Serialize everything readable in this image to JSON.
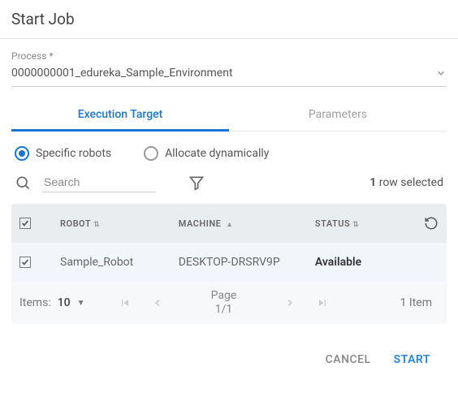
{
  "title": "Start Job",
  "process": {
    "label": "Process *",
    "value": "0000000001_edureka_Sample_Environment"
  },
  "tabs": {
    "execution": "Execution Target",
    "parameters": "Parameters"
  },
  "allocation": {
    "specific": "Specific robots",
    "dynamic": "Allocate dynamically"
  },
  "search": {
    "placeholder": "Search"
  },
  "selection": {
    "count": "1",
    "label": " row selected"
  },
  "table": {
    "headers": {
      "robot": "ROBOT",
      "machine": "MACHINE",
      "status": "STATUS"
    },
    "row": {
      "robot": "Sample_Robot",
      "machine": "DESKTOP-DRSRV9P",
      "status": "Available"
    }
  },
  "pager": {
    "itemsLabel": "Items:",
    "itemsValue": "10",
    "pageText": "Page",
    "pageNum": "1/1",
    "totalText": "1 Item"
  },
  "actions": {
    "cancel": "CANCEL",
    "start": "START"
  }
}
